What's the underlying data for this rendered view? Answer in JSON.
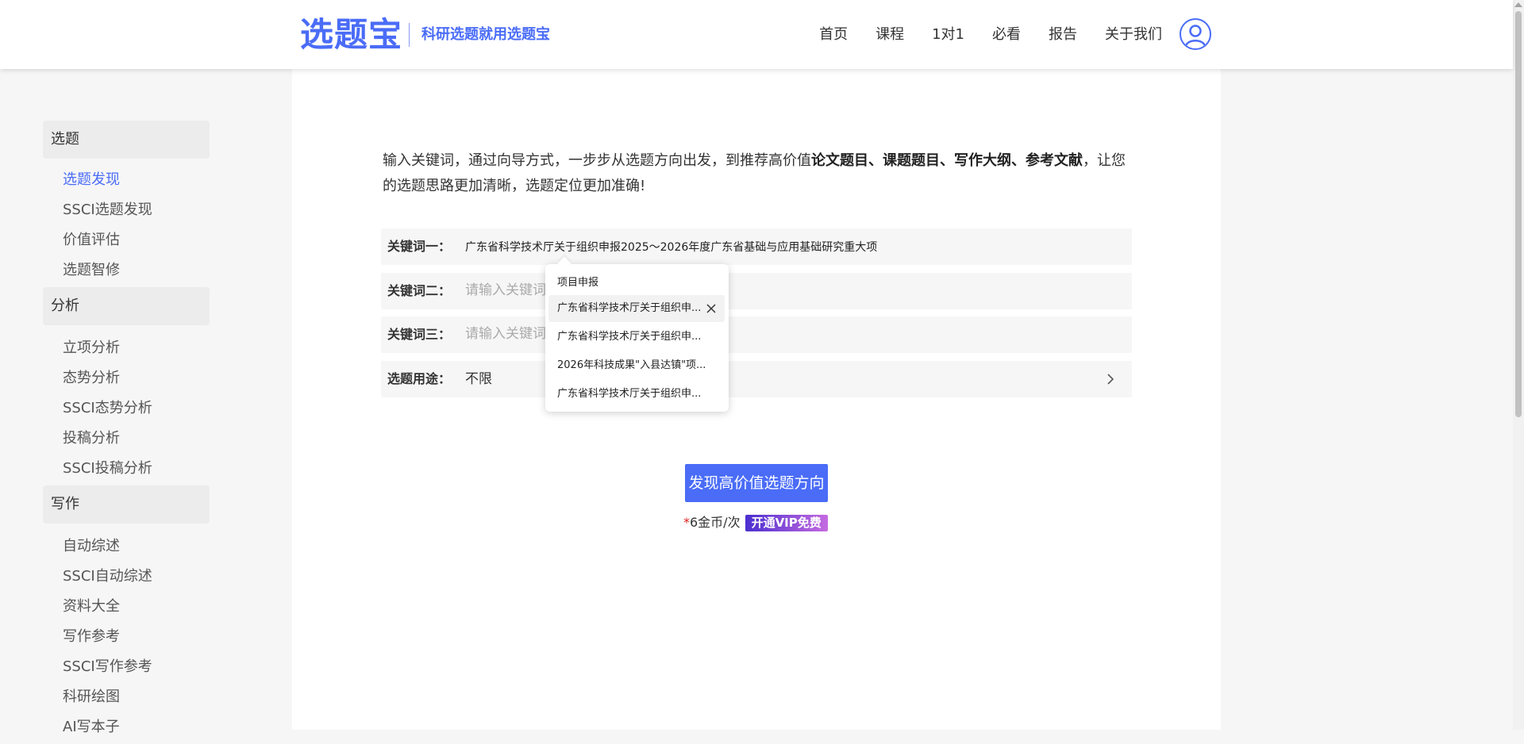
{
  "header": {
    "logo": "选题宝",
    "slogan": "科研选题就用选题宝",
    "nav": [
      "首页",
      "课程",
      "1对1",
      "必看",
      "报告",
      "关于我们"
    ]
  },
  "sidebar": {
    "groups": [
      {
        "title": "选题",
        "items": [
          "选题发现",
          "SSCI选题发现",
          "价值评估",
          "选题智修"
        ]
      },
      {
        "title": "分析",
        "items": [
          "立项分析",
          "态势分析",
          "SSCI态势分析",
          "投稿分析",
          "SSCI投稿分析"
        ]
      },
      {
        "title": "写作",
        "items": [
          "自动综述",
          "SSCI自动综述",
          "资料大全",
          "写作参考",
          "SSCI写作参考",
          "科研绘图",
          "AI写本子"
        ]
      }
    ],
    "active_item": "选题发现"
  },
  "intro": {
    "part1": "输入关键词，通过向导方式，一步步从选题方向出发，到推荐高价值",
    "bold": "论文题目、课题题目、写作大纲、参考文献",
    "part2": "，让您的选题思路更加清晰，选题定位更加准确!"
  },
  "form": {
    "keyword1": {
      "label": "关键词一：",
      "value": "广东省科学技术厅关于组织申报2025～2026年度广东省基础与应用基础研究重大项"
    },
    "keyword2": {
      "label": "关键词二：",
      "placeholder": "请输入关键词"
    },
    "keyword3": {
      "label": "关键词三：",
      "placeholder": "请输入关键词"
    },
    "purpose": {
      "label": "选题用途：",
      "value": "不限"
    }
  },
  "dropdown": {
    "items": [
      "项目申报",
      "广东省科学技术厅关于组织申...",
      "广东省科学技术厅关于组织申...",
      "2026年科技成果\"入县达镇\"项...",
      "广东省科学技术厅关于组织申..."
    ]
  },
  "action": {
    "button_label": "发现高价值选题方向",
    "cost_star": "*",
    "cost_text": "6金币/次",
    "vip_label": "开通VIP免费"
  },
  "colors": {
    "accent": "#4a6cf7",
    "required": "#e02020"
  }
}
